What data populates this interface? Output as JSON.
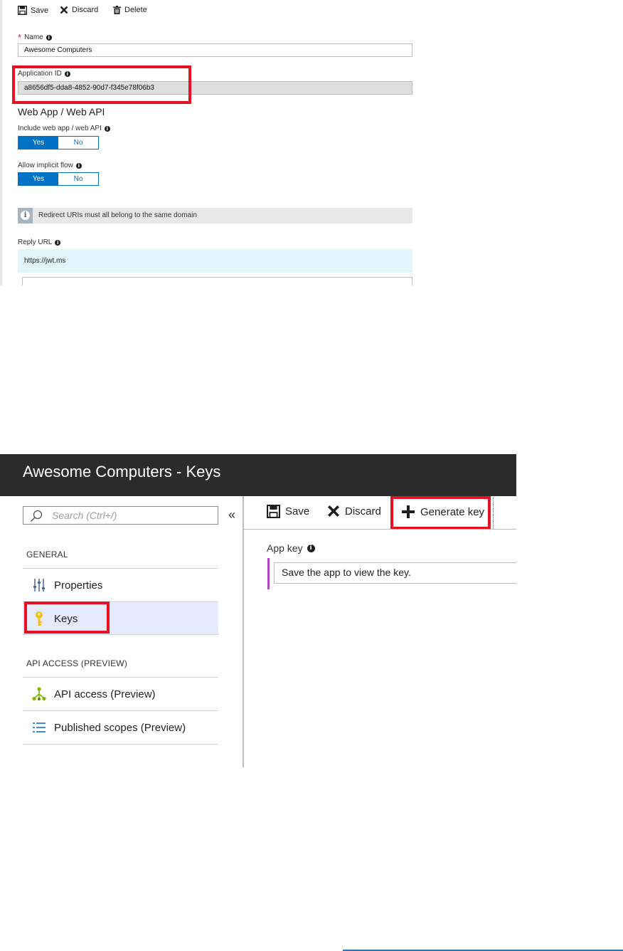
{
  "app_registration": {
    "toolbar": {
      "save": "Save",
      "discard": "Discard",
      "delete": "Delete"
    },
    "name": {
      "required_marker": "*",
      "label": "Name",
      "value": "Awesome Computers"
    },
    "application_id": {
      "label": "Application ID",
      "value": "a8656df5-dda8-4852-90d7-f345e78f06b3"
    },
    "section_title": "Web App / Web API",
    "include_web_app": {
      "label": "Include web app / web API",
      "yes": "Yes",
      "no": "No",
      "selected": "Yes"
    },
    "implicit_flow": {
      "label": "Allow implicit flow",
      "yes": "Yes",
      "no": "No",
      "selected": "Yes"
    },
    "info_banner": "Redirect URIs must all belong to the same domain",
    "reply_url": {
      "label": "Reply URL",
      "value": "https://jwt.ms"
    }
  },
  "keys_blade": {
    "title": "Awesome Computers - Keys",
    "search": {
      "placeholder": "Search (Ctrl+/)"
    },
    "collapse_glyph": "«",
    "general_header": "GENERAL",
    "general_items": [
      {
        "label": "Properties",
        "icon": "properties-icon"
      },
      {
        "label": "Keys",
        "icon": "key-icon",
        "selected": true
      }
    ],
    "api_header": "API ACCESS (PREVIEW)",
    "api_items": [
      {
        "label": "API access (Preview)",
        "icon": "api-access-icon"
      },
      {
        "label": "Published scopes (Preview)",
        "icon": "list-icon"
      }
    ],
    "toolbar": {
      "save": "Save",
      "discard": "Discard",
      "generate_key": "Generate key"
    },
    "app_key": {
      "label": "App key",
      "value": "Save the app to view the key."
    }
  },
  "colors": {
    "accent_blue": "#0072c6",
    "highlight_red": "#e81123",
    "title_bar": "#2b2b2b",
    "selected_nav": "#e5ebfa",
    "reply_url_bg": "#e1f5fb",
    "key_yellow": "#f0c419"
  }
}
